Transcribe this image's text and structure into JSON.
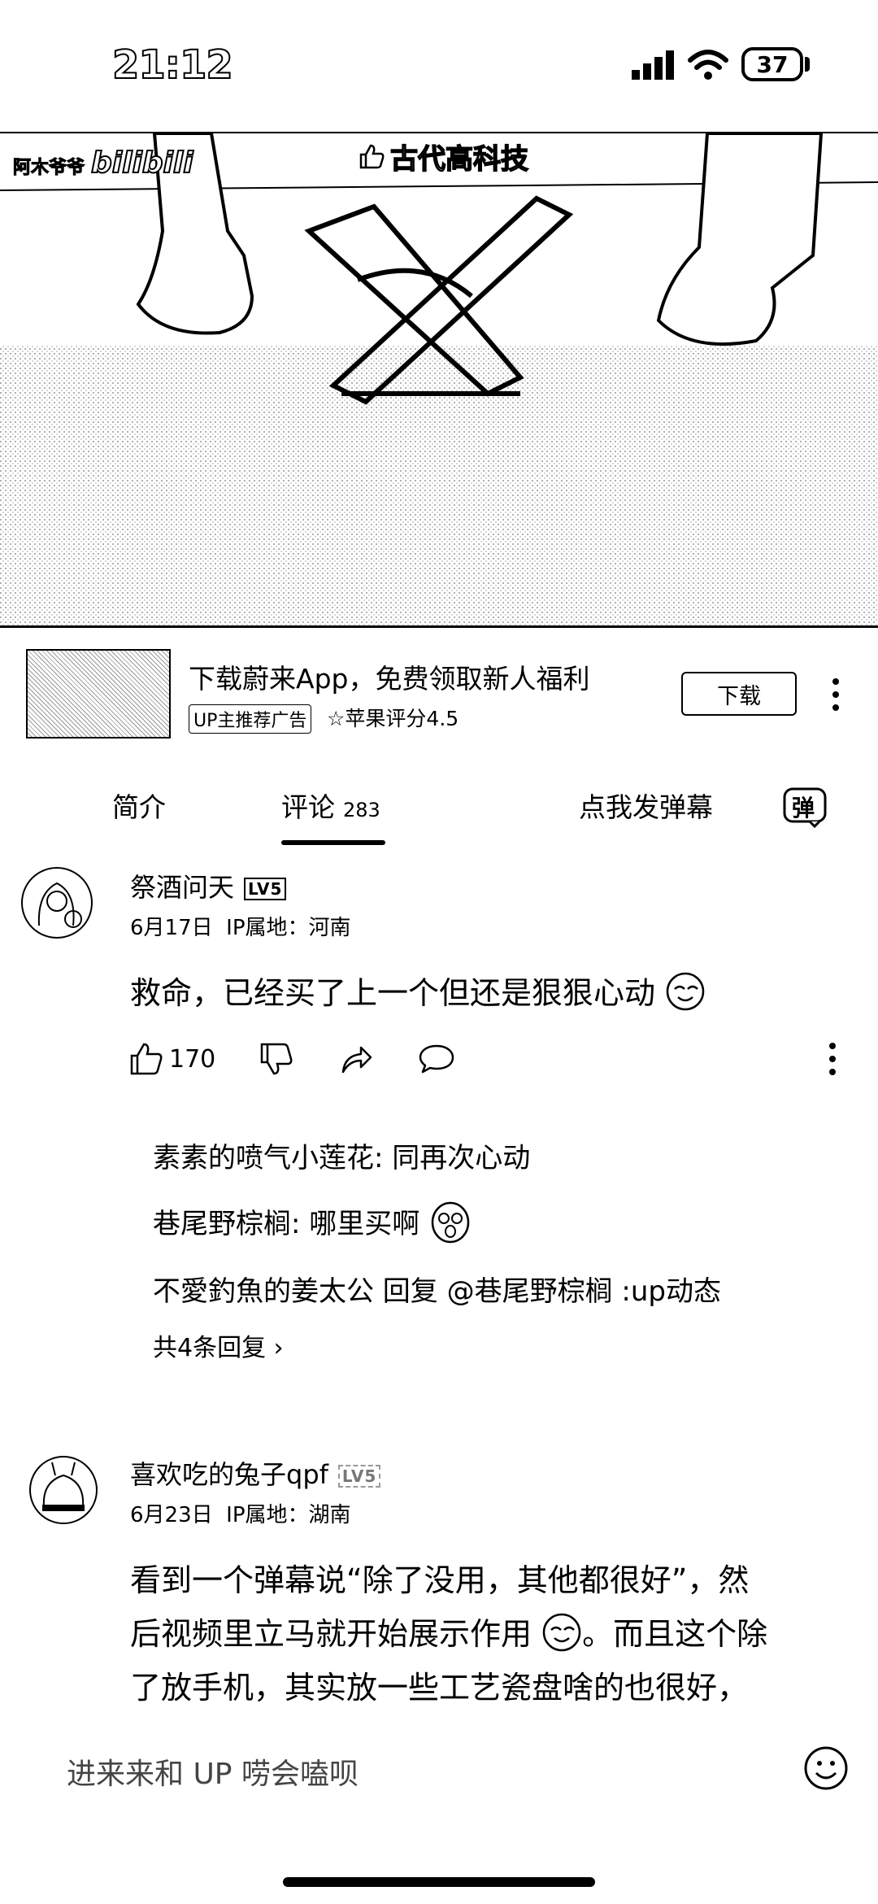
{
  "status_bar": {
    "time": "21:12",
    "battery": "37"
  },
  "video": {
    "tag": "古代高科技",
    "channel": "阿木爷爷",
    "watermark": "bilibili"
  },
  "ad": {
    "title": "下载蔚来App，免费领取新人福利",
    "badge": "UP主推荐广告",
    "rating": "☆苹果评分4.5",
    "button": "下载"
  },
  "tabs": [
    {
      "label": "简介"
    },
    {
      "label": "评论",
      "count": "283"
    },
    {
      "label": "点我发弹幕"
    }
  ],
  "danmaku_icon_label": "弹",
  "comments": [
    {
      "username": "祭酒问天",
      "level": "LV5",
      "date": "6月17日",
      "ip": "IP属地：河南",
      "content": "救命，已经买了上一个但还是狠狠心动",
      "likes": "170",
      "replies": [
        {
          "name": "素素的喷气小莲花",
          "text": ": 同再次心动"
        },
        {
          "name": "巷尾野棕榈",
          "text": ": 哪里买啊"
        },
        {
          "name": "不愛釣魚的姜太公",
          "text": " 回复 @巷尾野棕榈 :up动态"
        }
      ],
      "reply_summary": "共4条回复 ›"
    },
    {
      "username": "喜欢吃的兔子qpf",
      "level": "LV5",
      "date": "6月23日",
      "ip": "IP属地：湖南",
      "content_lines": [
        "看到一个弹幕说“除了没用，其他都很好”，然",
        "后视频里立马就开始展示作用",
        "了放手机，其实放一些工艺瓷盘啥的也很好，"
      ],
      "content_line2_tail": "。而且这个除"
    }
  ],
  "input": {
    "placeholder": "进来来和 UP 唠会嗑呗"
  }
}
